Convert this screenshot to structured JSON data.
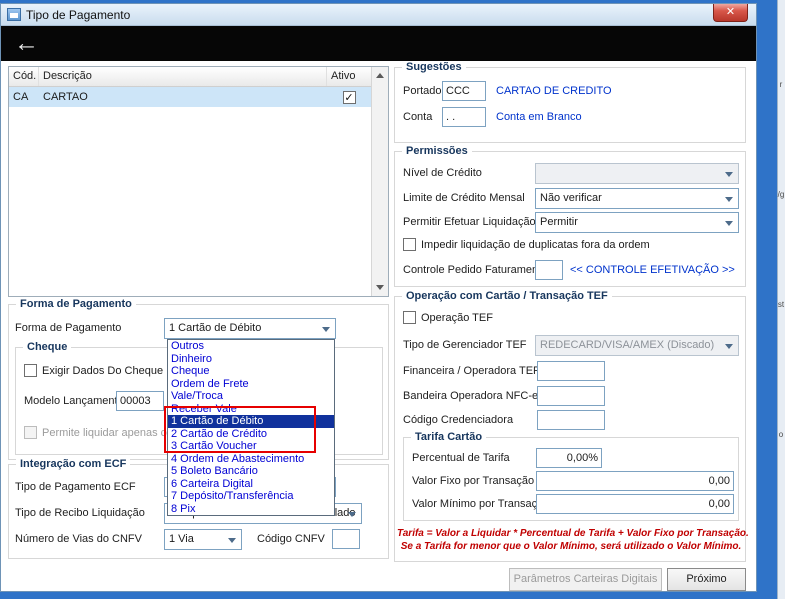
{
  "window": {
    "title": "Tipo de Pagamento",
    "close_glyph": "✕",
    "back_glyph": "←"
  },
  "edge_fragments": [
    "r",
    "/g",
    "st",
    "o"
  ],
  "grid": {
    "headers": {
      "cod": "Cód.",
      "descricao": "Descrição",
      "ativo": "Ativo"
    },
    "rows": [
      {
        "cod": "CA",
        "descricao": "CARTAO",
        "check_glyph": "✓"
      }
    ]
  },
  "sugestoes": {
    "title": "Sugestões",
    "portador": {
      "label": "Portador",
      "value": "CCC",
      "hint": "CARTAO DE CREDITO"
    },
    "conta": {
      "label": "Conta",
      "value": ". .",
      "hint": "Conta em Branco"
    }
  },
  "permissoes": {
    "title": "Permissões",
    "nivel_credito": {
      "label": "Nível de Crédito",
      "value": ""
    },
    "limite_credito": {
      "label": "Limite de Crédito Mensal",
      "value": "Não verificar"
    },
    "permitir_liquidacao": {
      "label": "Permitir Efetuar Liquidação",
      "value": "Permitir"
    },
    "impedir_checkbox": "Impedir liquidação de duplicatas fora da ordem",
    "controle_pedido": {
      "label": "Controle Pedido Faturamento",
      "value": "",
      "link": "<< CONTROLE EFETIVAÇÃO >>"
    }
  },
  "forma_pagamento": {
    "title": "Forma de Pagamento",
    "label": "Forma de Pagamento",
    "value": "1 Cartão de Débito",
    "cheque": {
      "title": "Cheque",
      "exigir_checkbox": "Exigir Dados Do Cheque",
      "modelo_label": "Modelo Lançamento",
      "modelo_value": "00003",
      "permite_checkbox": "Permite liquidar apenas co"
    }
  },
  "dropdown": {
    "selected_index": 6,
    "items": [
      "Outros",
      "Dinheiro",
      "Cheque",
      "Ordem de Frete",
      "Vale/Troca",
      "Receber Vale",
      "1 Cartão de Débito",
      "2 Cartão de Crédito",
      "3 Cartão Voucher",
      "4 Ordem de Abastecimento",
      "5 Boleto Bancário",
      "6 Carteira Digital",
      "7 Depósito/Transferência",
      "8 Pix"
    ]
  },
  "integracao_ecf": {
    "title": "Integração com ECF",
    "tipo_pagamento": {
      "label": "Tipo de Pagamento ECF",
      "value": ""
    },
    "tipo_recibo": {
      "label": "Tipo de Recibo Liquidação",
      "value": "Comprovante não fiscal não vinculado"
    },
    "num_vias": {
      "label": "Número de Vias do CNFV",
      "value": "1 Via"
    },
    "codigo_cnfv": {
      "label": "Código CNFV",
      "value": ""
    }
  },
  "operacao_tef": {
    "title": "Operação com Cartão / Transação TEF",
    "operacao_checkbox": "Operação TEF",
    "gerenciador": {
      "label": "Tipo de Gerenciador TEF",
      "value": "REDECARD/VISA/AMEX (Discado)"
    },
    "financeira": {
      "label": "Financeira / Operadora TEF",
      "value": ""
    },
    "bandeira": {
      "label": "Bandeira Operadora NFC-e",
      "value": ""
    },
    "credenciadora": {
      "label": "Código Credenciadora",
      "value": ""
    },
    "tarifa": {
      "title": "Tarifa Cartão",
      "percentual": {
        "label": "Percentual de Tarifa",
        "value": "0,00%"
      },
      "valor_fixo": {
        "label": "Valor Fixo por Transação",
        "value": "0,00"
      },
      "valor_minimo": {
        "label": "Valor Mínimo por Transação",
        "value": "0,00"
      }
    },
    "nota_line1": "Tarifa = Valor a Liquidar *  Percentual de Tarifa + Valor Fixo por Transação.",
    "nota_line2": "Se a Tarifa for menor que o Valor Mínimo, será utilizado o Valor Mínimo."
  },
  "buttons": {
    "parametros": "Parâmetros Carteiras Digitais",
    "proximo": "Próximo"
  }
}
